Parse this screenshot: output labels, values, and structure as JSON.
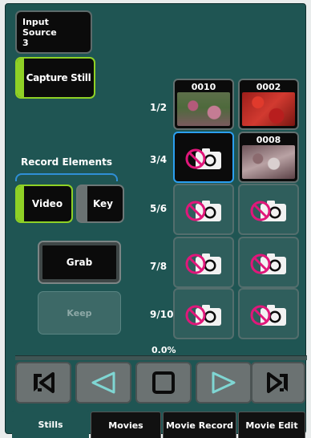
{
  "input_source": {
    "label": "Input Source",
    "value": "3"
  },
  "capture_still": {
    "label": "Capture Still"
  },
  "record_elements": {
    "label": "Record Elements",
    "video_label": "Video",
    "key_label": "Key"
  },
  "grab_label": "Grab",
  "keep_label": "Keep",
  "rows": [
    "1/2",
    "3/4",
    "5/6",
    "7/8",
    "9/10"
  ],
  "slots": [
    {
      "number": "0010",
      "state": "image"
    },
    {
      "number": "0002",
      "state": "image"
    },
    {
      "number": "",
      "state": "empty-selected"
    },
    {
      "number": "0008",
      "state": "image"
    },
    {
      "number": "",
      "state": "empty"
    },
    {
      "number": "",
      "state": "empty"
    },
    {
      "number": "",
      "state": "empty"
    },
    {
      "number": "",
      "state": "empty"
    },
    {
      "number": "",
      "state": "empty"
    },
    {
      "number": "",
      "state": "empty"
    }
  ],
  "progress": {
    "text": "0.0%",
    "fraction": 0.0
  },
  "transport": {
    "icons": [
      "skip-to-start-icon",
      "play-reverse-icon",
      "stop-icon",
      "play-icon",
      "skip-to-end-icon"
    ]
  },
  "tabs": [
    {
      "label": "Stills",
      "active": true
    },
    {
      "label": "Movies",
      "active": false
    },
    {
      "label": "Movie Record",
      "active": false
    },
    {
      "label": "Movie Edit",
      "active": false
    }
  ],
  "colors": {
    "panel": "#1f5553",
    "accent_green": "#8fd126",
    "selection_blue": "#2b9ff0",
    "transport_icon": "#7fd6d3",
    "no_image_icon": "#e0177a"
  }
}
